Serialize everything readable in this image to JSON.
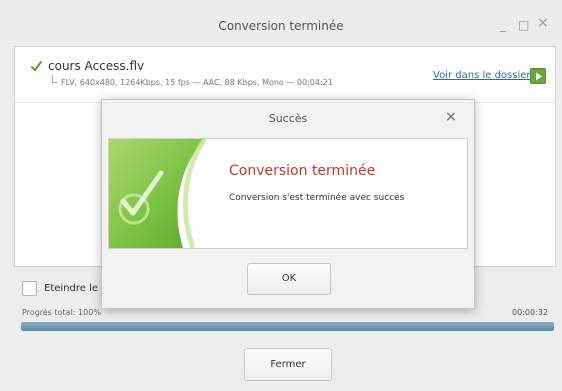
{
  "window": {
    "title": "Conversion terminée",
    "minimize": "_",
    "maximize": "□",
    "close": "×"
  },
  "file": {
    "name": "cours Access.flv",
    "details": "FLV, 640x480, 1264Kbps, 15 fps — AAC, 88 Kbps, Mono — 00:04:21",
    "open_folder_label": "Voir dans le dossier",
    "status_icon": "check-icon"
  },
  "options": {
    "shutdown_label": "Eteindre le PC",
    "shutdown_checked": false
  },
  "progress": {
    "label": "Progrès total: 100%",
    "time": "00:00:32",
    "value": 1.0,
    "color": "#6e99ab"
  },
  "footer": {
    "close_label": "Fermer"
  },
  "dialog": {
    "title": "Succès",
    "close": "×",
    "heading": "Conversion terminée",
    "message": "Conversion s'est terminée avec succès",
    "ok_label": "OK",
    "accent_color": "#c0392b",
    "graphic_color": "#7cc242"
  }
}
